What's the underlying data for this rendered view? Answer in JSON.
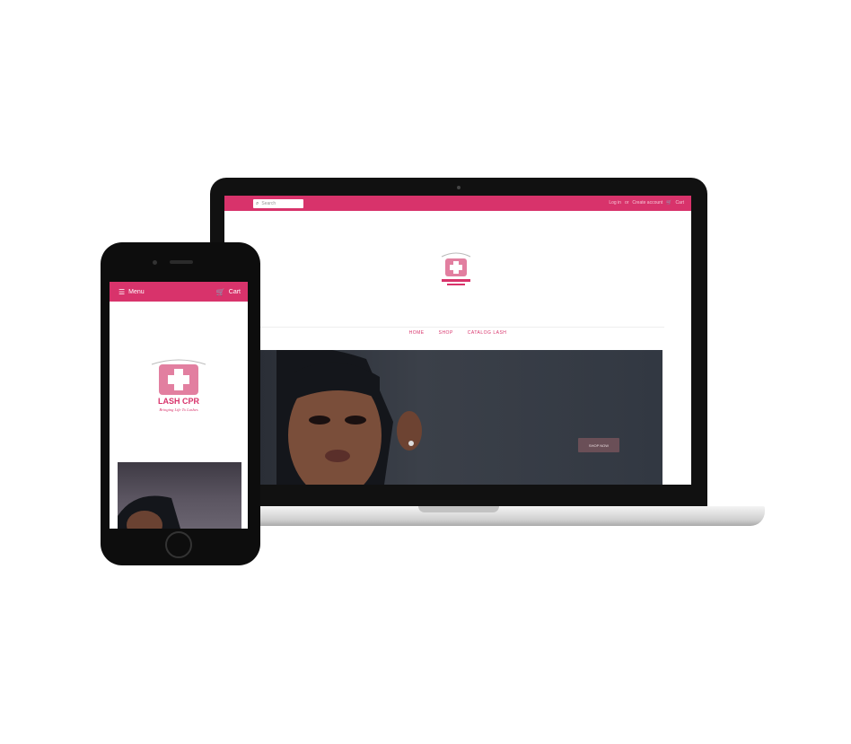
{
  "desktop": {
    "search_placeholder": "Search",
    "account_links": [
      "Log in",
      "or",
      "Create account"
    ],
    "cart_label": "Cart",
    "nav": [
      "HOME",
      "SHOP",
      "CATALOG LASH"
    ],
    "hero_button": "SHOP NOW"
  },
  "mobile": {
    "menu_label": "Menu",
    "cart_label": "Cart"
  },
  "brand": {
    "name": "LASH CPR",
    "tagline": "Bringing Life To Lashes",
    "accent": "#d8336b"
  }
}
